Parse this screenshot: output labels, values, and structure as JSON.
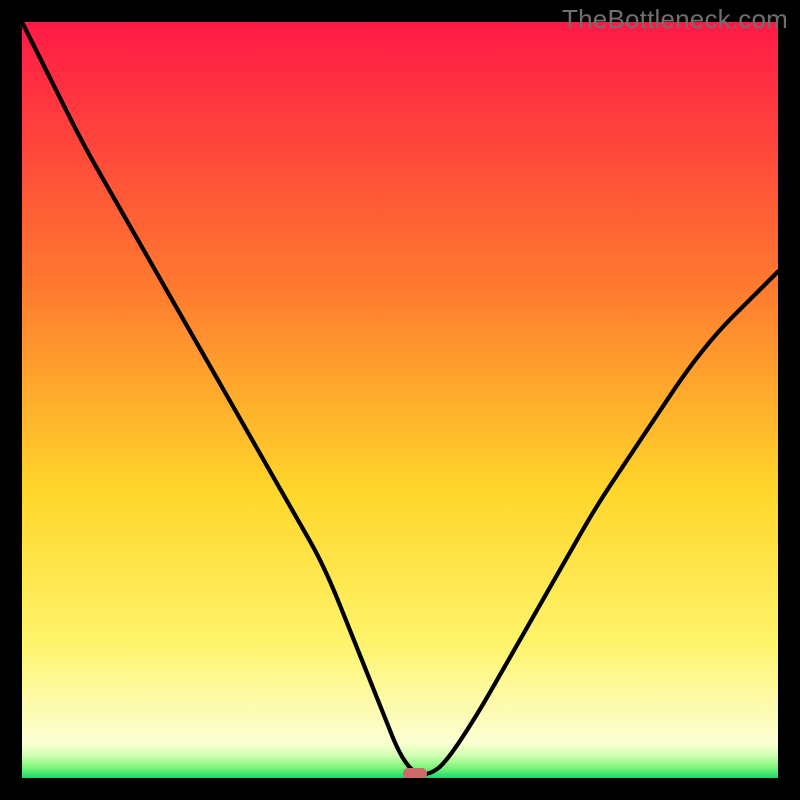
{
  "watermark": "TheBottleneck.com",
  "colors": {
    "top": "#ff1946",
    "mid_upper": "#ff7a2f",
    "mid": "#ffd62a",
    "lower": "#fff46b",
    "pale": "#fcffd3",
    "green_faint": "#d1ffb3",
    "green_mid": "#7ef57a",
    "green_deep": "#18d86a",
    "curve": "#000000",
    "marker": "#cf6a68",
    "bg": "#000000",
    "watermark_color": "#6f6f6f"
  },
  "chart_data": {
    "type": "line",
    "title": "",
    "xlabel": "",
    "ylabel": "",
    "xlim": [
      0,
      100
    ],
    "ylim": [
      0,
      100
    ],
    "x": [
      0,
      4,
      8,
      12,
      16,
      20,
      24,
      28,
      32,
      36,
      40,
      44,
      46,
      48,
      50,
      52,
      54,
      56,
      60,
      64,
      68,
      72,
      76,
      80,
      84,
      88,
      92,
      96,
      100
    ],
    "values": [
      100,
      92,
      84,
      77,
      70,
      63,
      56,
      49,
      42,
      35,
      28,
      18,
      13,
      8,
      3,
      0.5,
      0.5,
      2,
      8,
      15,
      22,
      29,
      36,
      42,
      48,
      54,
      59,
      63,
      67
    ],
    "min_point": {
      "x": 52,
      "y": 0.5
    },
    "marker": {
      "x": 52,
      "y": 0.5
    }
  }
}
